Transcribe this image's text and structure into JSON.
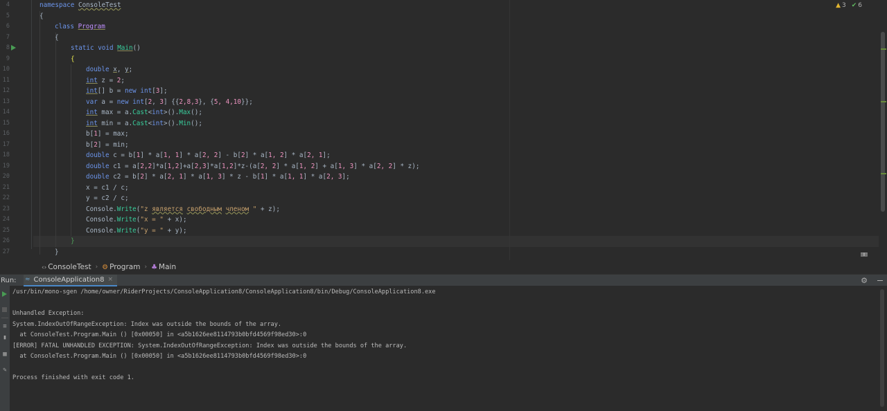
{
  "editor": {
    "line_numbers": [
      "4",
      "5",
      "6",
      "7",
      "8",
      "9",
      "10",
      "11",
      "12",
      "13",
      "14",
      "15",
      "16",
      "17",
      "18",
      "19",
      "20",
      "21",
      "22",
      "23",
      "24",
      "25",
      "26",
      "27"
    ],
    "inspections": {
      "warnings": "3",
      "ok": "6"
    }
  },
  "code": {
    "ns_kw": "namespace",
    "ns_name": "ConsoleTest",
    "brace_open": "{",
    "brace_close": "}",
    "class_kw": "class",
    "class_name": "Program",
    "static_kw": "static",
    "void_kw": "void",
    "main_name": "Main",
    "main_parens": "()",
    "l10": {
      "kw": "double",
      "sp": " ",
      "x": "x",
      "comma": ", ",
      "y": "y",
      "semi": ";"
    },
    "l11": {
      "kw": "int",
      "rest": " z = ",
      "n": "2",
      "semi": ";"
    },
    "l12": {
      "kw": "int",
      "p1": "[] b = ",
      "new": "new",
      "sp": " ",
      "kw2": "int",
      "p2": "[",
      "n": "3",
      "p3": "];"
    },
    "l13": {
      "kw": "var",
      "p1": " a = ",
      "new": "new",
      "sp": " ",
      "kw2": "int",
      "p2": "[",
      "n1": "2",
      "p3": ", ",
      "n2": "3",
      "p4": "] {{",
      "n3": "2,8,3",
      "p5": "}, {",
      "n4": "5, 4,10",
      "p6": "}};"
    },
    "l14": {
      "kw": "int",
      "p1": " max = a.",
      "f1": "Cast",
      "p2": "<",
      "kw2": "int",
      "p3": ">().",
      "f2": "Max",
      "p4": "();"
    },
    "l15": {
      "kw": "int",
      "p1": " min = a.",
      "f1": "Cast",
      "p2": "<",
      "kw2": "int",
      "p3": ">().",
      "f2": "Min",
      "p4": "();"
    },
    "l16": {
      "p1": "b[",
      "n": "1",
      "p2": "] = max;"
    },
    "l17": {
      "p1": "b[",
      "n": "2",
      "p2": "] = min;"
    },
    "l18": {
      "kw": "double",
      "p1": " c = b[",
      "n1": "1",
      "p2": "] * a[",
      "n2": "1, 1",
      "p3": "] * a[",
      "n3": "2, 2",
      "p4": "] - b[",
      "n4": "2",
      "p5": "] * a[",
      "n5": "1, 2",
      "p6": "] * a[",
      "n6": "2, 1",
      "p7": "];"
    },
    "l19": {
      "kw": "double",
      "p1": " c1 = a[",
      "n1": "2,2",
      "p2": "]*a[",
      "n2": "1,2",
      "p3": "]+a[",
      "n3": "2,3",
      "p4": "]*a[",
      "n4": "1,2",
      "p5": "]*z-(a[",
      "n5": "2, 2",
      "p6": "] * a[",
      "n6": "1, 2",
      "p7": "] + a[",
      "n7": "1, 3",
      "p8": "] * a[",
      "n8": "2, 2",
      "p9": "] * z);"
    },
    "l20": {
      "kw": "double",
      "p1": " c2 = b[",
      "n1": "2",
      "p2": "] * a[",
      "n2": "2, 1",
      "p3": "] * a[",
      "n3": "1, 3",
      "p4": "] * z - b[",
      "n4": "1",
      "p5": "] * a[",
      "n5": "1, 1",
      "p6": "] * a[",
      "n6": "2, 3",
      "p7": "];"
    },
    "l21": {
      "text": "x = c1 / c;"
    },
    "l22": {
      "text": "y = c2 / c;"
    },
    "l23": {
      "obj": "Console.",
      "fn": "Write",
      "p1": "(",
      "s1": "\"z ",
      "s2": "является",
      "s3": " ",
      "s4": "свободным",
      "s5": " ",
      "s6": "членом",
      "s7": " \"",
      "p2": " + z);"
    },
    "l24": {
      "obj": "Console.",
      "fn": "Write",
      "p1": "(",
      "s": "\"x = \"",
      "p2": " + x);"
    },
    "l25": {
      "obj": "Console.",
      "fn": "Write",
      "p1": "(",
      "s": "\"y = \"",
      "p2": " + y);"
    }
  },
  "breadcrumb": {
    "namespace_icon": "‹›",
    "namespace": "ConsoleTest",
    "sep": "›",
    "class": "Program",
    "method": "Main"
  },
  "run": {
    "label": "Run:",
    "tab": "ConsoleApplication8",
    "tab_close": "×",
    "gear": "⚙"
  },
  "console": {
    "lines": [
      "/usr/bin/mono-sgen /home/owner/RiderProjects/ConsoleApplication8/ConsoleApplication8/bin/Debug/ConsoleApplication8.exe",
      "",
      "Unhandled Exception:",
      "System.IndexOutOfRangeException: Index was outside the bounds of the array.",
      "  at ConsoleTest.Program.Main () [0x00050] in <a5b1626ee8114793b0bfd4569f98ed30>:0",
      "[ERROR] FATAL UNHANDLED EXCEPTION: System.IndexOutOfRangeException: Index was outside the bounds of the array.",
      "  at ConsoleTest.Program.Main () [0x00050] in <a5b1626ee8114793b0bfd4569f98ed30>:0",
      "",
      "Process finished with exit code 1."
    ]
  },
  "colors": {
    "editor_bg": "#2b2b2b",
    "keyword": "#6c95eb",
    "type": "#c191ff",
    "number": "#ed94c0",
    "method": "#39cc9b",
    "string": "#c9a26d",
    "run_green": "#499c54"
  }
}
